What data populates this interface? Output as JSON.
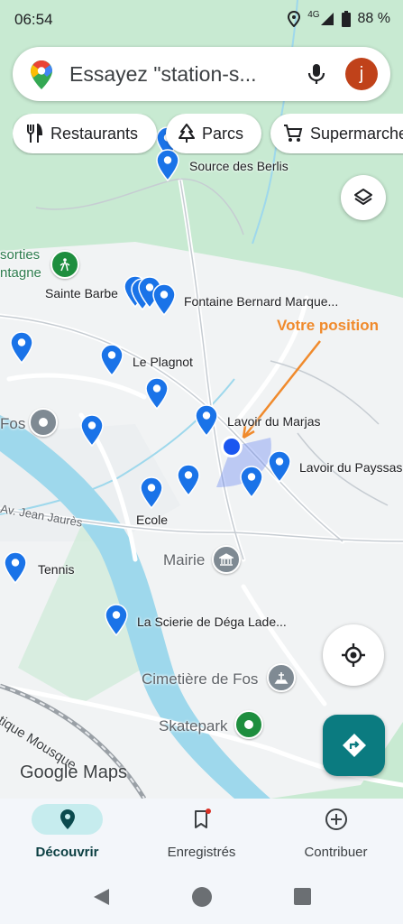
{
  "status_bar": {
    "time": "06:54",
    "network": "4G",
    "battery": "88 %"
  },
  "search": {
    "placeholder": "Essayez \"station-s...",
    "avatar_letter": "j"
  },
  "chips": [
    {
      "label": "Restaurants",
      "icon": "fork-knife-icon"
    },
    {
      "label": "Parcs",
      "icon": "tree-icon"
    },
    {
      "label": "Supermarche",
      "icon": "cart-icon"
    }
  ],
  "map_labels": {
    "source": "Source des Berlis",
    "sorties": "sorties",
    "montagne": "ntagne",
    "sainte_barbe": "Sainte Barbe",
    "fontaine": "Fontaine Bernard Marque...",
    "plagnot": "Le Plagnot",
    "fos_left": "Fos",
    "lavoir_marjas": "Lavoir du Marjas",
    "lavoir_payssas": "Lavoir du Payssas",
    "avenue": "Av. Jean Jaurès",
    "ecole": "Ecole",
    "mairie": "Mairie",
    "tennis": "Tennis",
    "scierie": "La Scierie de Déga Lade...",
    "cimetiere": "Cimetière de Fos",
    "skatepark": "Skatepark",
    "route": "tique Mousque"
  },
  "annotation": "Votre position",
  "attribution": "Google Maps",
  "bottom_nav": [
    {
      "label": "Découvrir",
      "icon": "explore-pin-icon",
      "active": true
    },
    {
      "label": "Enregistrés",
      "icon": "bookmark-icon",
      "active": false
    },
    {
      "label": "Contribuer",
      "icon": "add-circle-icon",
      "active": false
    }
  ],
  "colors": {
    "pin": "#1a73e8",
    "accent": "#0b7b80",
    "annotation": "#f08a2c",
    "park": "#bfe6c8",
    "water": "#9ed8ec"
  }
}
